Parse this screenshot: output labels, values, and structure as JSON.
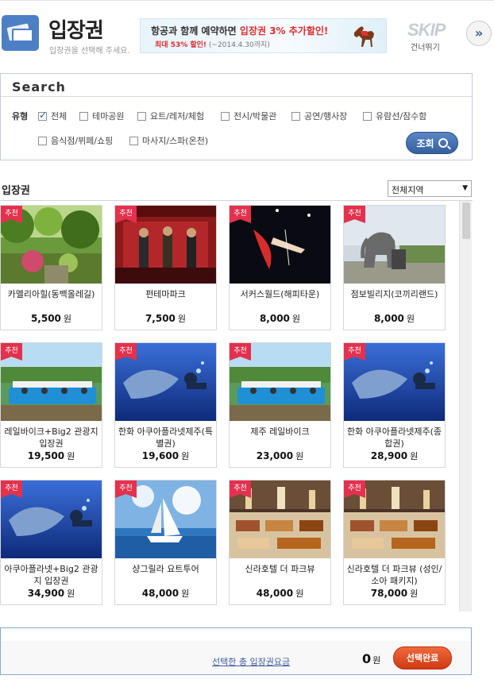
{
  "header": {
    "title": "입장권",
    "subtitle": "입장권을 선택해 주세요.",
    "banner_line1_a": "항공과 함께 예약하면 ",
    "banner_line1_b": "입장권 3% 추가할인!",
    "banner_line2_a": "최대 53% 할인!",
    "banner_line2_b": " (~2014.4.30까지)",
    "skip": "SKIP",
    "skip_sub": "건너뛰기",
    "skip_arrow": "»"
  },
  "search": {
    "title": "Search",
    "type_label": "유형",
    "options": [
      {
        "label": "전체",
        "checked": true
      },
      {
        "label": "테마공원",
        "checked": false
      },
      {
        "label": "요트/레저/체험",
        "checked": false
      },
      {
        "label": "전시/박물관",
        "checked": false
      },
      {
        "label": "공연/행사장",
        "checked": false
      },
      {
        "label": "유람선/잠수함",
        "checked": false
      },
      {
        "label": "음식점/뷔페/쇼핑",
        "checked": false
      },
      {
        "label": "마사지/스파(온천)",
        "checked": false
      }
    ],
    "button": "조회"
  },
  "list": {
    "title": "입장권",
    "region": "전체지역",
    "badge": "추천",
    "unit": "원",
    "items": [
      {
        "name": "카멜리아힐(동백올레길)",
        "price": "5,500",
        "thumb": "garden"
      },
      {
        "name": "펀테마파크",
        "price": "7,500",
        "thumb": "theater"
      },
      {
        "name": "서커스월드(해피타운)",
        "price": "8,000",
        "thumb": "circus"
      },
      {
        "name": "점보빌리지(코끼리랜드)",
        "price": "8,000",
        "thumb": "elephant"
      },
      {
        "name": "레일바이크+Big2 관광지 입장권",
        "price": "19,500",
        "thumb": "railbike"
      },
      {
        "name": "한화 아쿠아플라넷제주(특별권)",
        "price": "19,600",
        "thumb": "aquarium"
      },
      {
        "name": "제주 레일바이크",
        "price": "23,000",
        "thumb": "railbike"
      },
      {
        "name": "한화 아쿠아플라넷제주(종합권)",
        "price": "28,900",
        "thumb": "aquarium"
      },
      {
        "name": "아쿠아플라넷+Big2 관광지 입장권",
        "price": "34,900",
        "thumb": "aquarium"
      },
      {
        "name": "샹그릴라 요트투어",
        "price": "48,000",
        "thumb": "yacht"
      },
      {
        "name": "신라호텔 더 파크뷰",
        "price": "48,000",
        "thumb": "buffet"
      },
      {
        "name": "신라호텔 더 파크뷰 (성인/소아 패키지)",
        "price": "78,000",
        "thumb": "buffet"
      }
    ]
  },
  "footer": {
    "summary_label": "선택한 총 입장권요금",
    "total": "0",
    "unit": "원",
    "done_button": "선택완료"
  }
}
